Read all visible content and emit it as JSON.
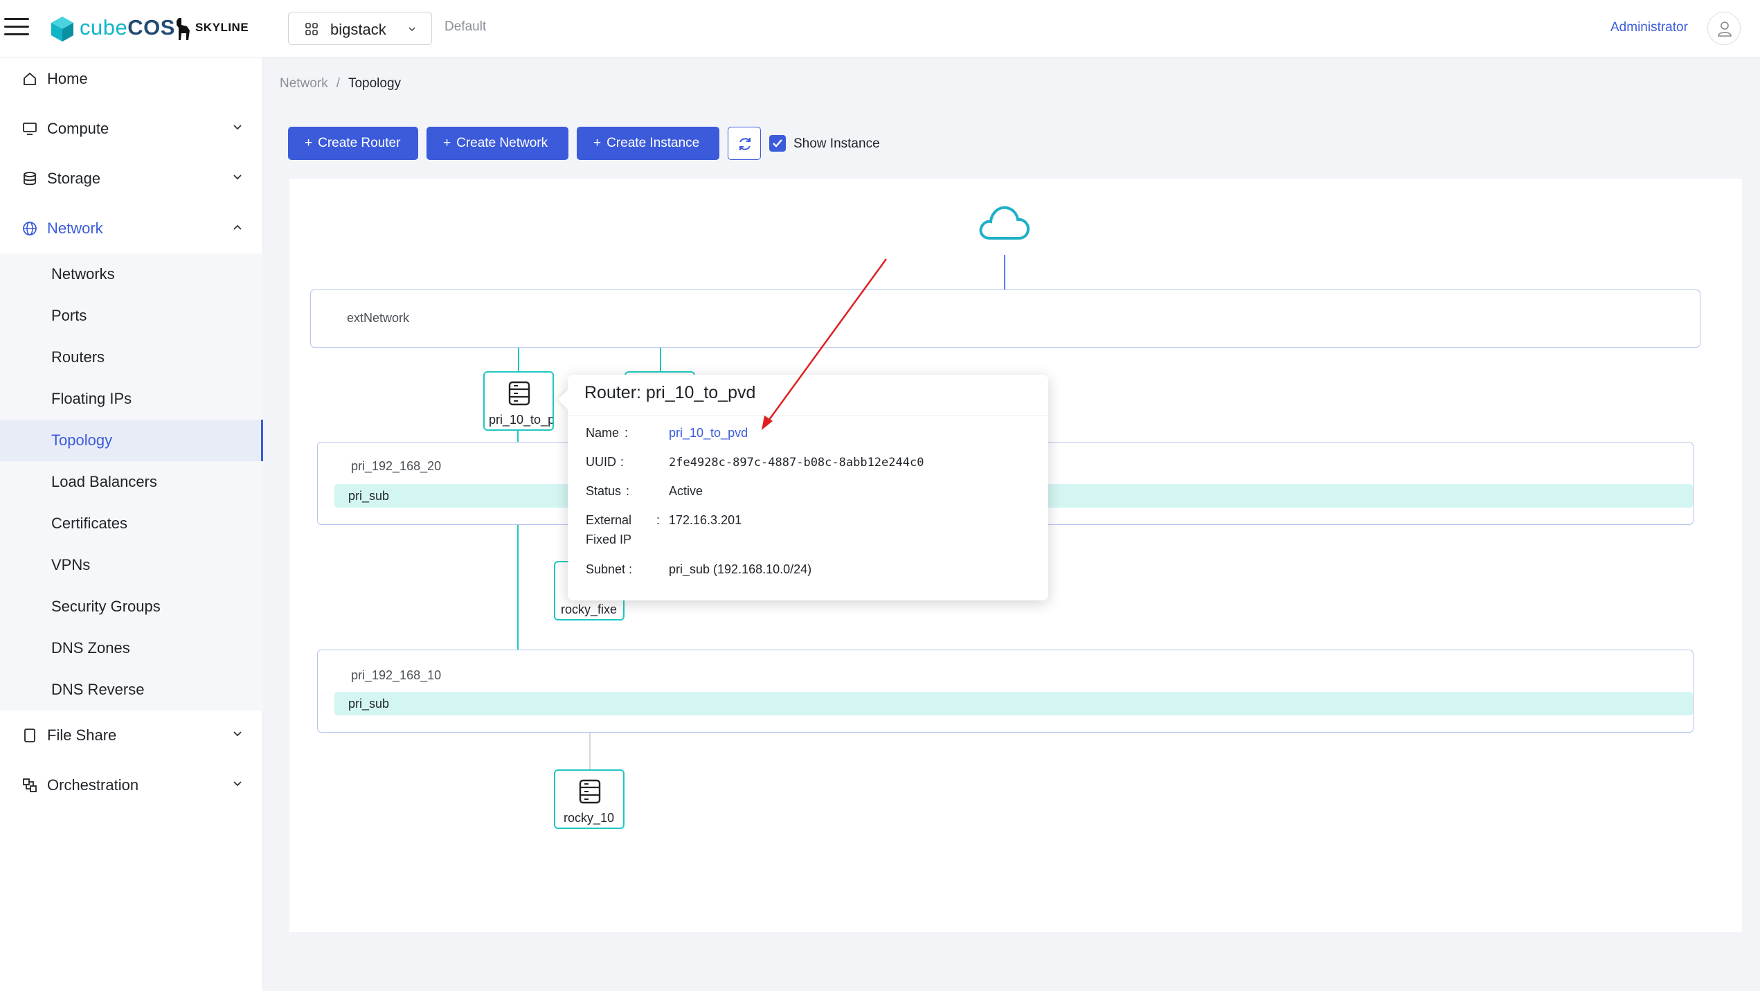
{
  "header": {
    "brand_prefix": "cube",
    "brand_suffix": "COS",
    "partner": "SKYLINE",
    "project": "bigstack",
    "domain": "Default",
    "user": "Administrator"
  },
  "sidebar": {
    "home": "Home",
    "compute": "Compute",
    "storage": "Storage",
    "network": "Network",
    "network_items": [
      "Networks",
      "Ports",
      "Routers",
      "Floating IPs",
      "Topology",
      "Load Balancers",
      "Certificates",
      "VPNs",
      "Security Groups",
      "DNS Zones",
      "DNS Reverse"
    ],
    "file_share": "File Share",
    "orchestration": "Orchestration"
  },
  "breadcrumb": {
    "parent": "Network",
    "current": "Topology"
  },
  "toolbar": {
    "create_router": "Create Router",
    "create_network": "Create Network",
    "create_instance": "Create Instance",
    "show_instance": "Show Instance",
    "show_instance_checked": true
  },
  "topology": {
    "external_network": "extNetwork",
    "networks": [
      {
        "name": "pri_192_168_20",
        "subnet": "pri_sub"
      },
      {
        "name": "pri_192_168_10",
        "subnet": "pri_sub"
      }
    ],
    "router_node": "pri_10_to_p",
    "instance_nodes": [
      "rocky_fixe",
      "rocky_10"
    ]
  },
  "popover": {
    "title": "Router: pri_10_to_pvd",
    "name_label": "Name",
    "name_value": "pri_10_to_pvd",
    "uuid_label": "UUID",
    "uuid_value": "2fe4928c-897c-4887-b08c-8abb12e244c0",
    "status_label": "Status",
    "status_value": "Active",
    "ext_ip_label_1": "External",
    "ext_ip_label_2": "Fixed IP",
    "ext_ip_value": "172.16.3.201",
    "subnet_label": "Subnet",
    "subnet_value": "pri_sub (192.168.10.0/24)"
  },
  "colors": {
    "primary": "#3b5bdb",
    "teal": "#1fc7c1",
    "subnet_fill": "#d4f6f3",
    "annotation": "#e02020"
  }
}
